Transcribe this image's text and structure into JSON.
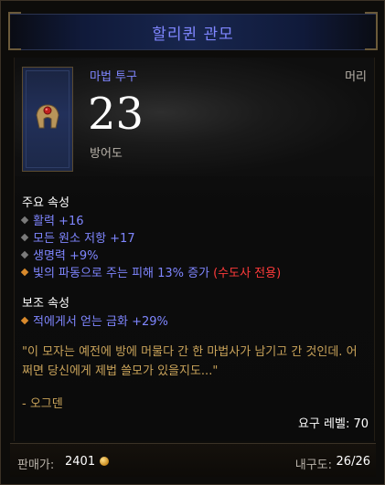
{
  "item": {
    "name": "할리퀸 관모",
    "type": "마법 투구",
    "slot": "머리",
    "armor_value": "23",
    "armor_label": "방어도"
  },
  "primary": {
    "title": "주요 속성",
    "props": [
      {
        "text": "활력 +16"
      },
      {
        "text": "모든 원소 저항 +17"
      },
      {
        "text": "생명력 +9%"
      },
      {
        "text": "빛의 파동으로 주는 피해 13% 증가",
        "tag": "(수도사 전용)"
      }
    ]
  },
  "secondary": {
    "title": "보조 속성",
    "props": [
      {
        "text": "적에게서 얻는 금화 +29%"
      }
    ]
  },
  "flavor": {
    "text": "\"이 모자는 예전에 방에 머물다 간 한 마법사가 남기고 간 것인데. 어쩌면 당신에게 제법 쓸모가 있을지도...\"",
    "author": "- 오그덴"
  },
  "requirement": "요구 레벨: 70",
  "footer": {
    "sell_label": "판매가:",
    "sell_value": "2401",
    "durability_label": "내구도:",
    "durability_value": "26/26"
  },
  "colors": {
    "magic": "#7f86ff",
    "flavor": "#c9a35a",
    "class_restriction": "#ff3b3b"
  }
}
